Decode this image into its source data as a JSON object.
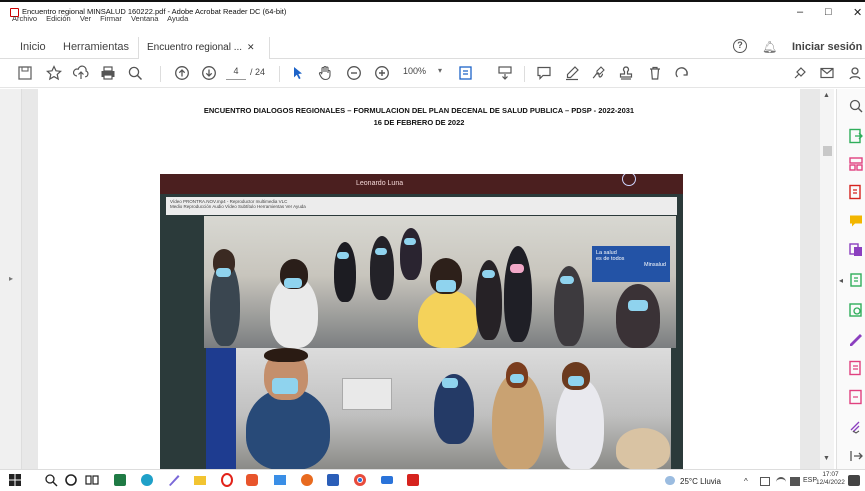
{
  "window": {
    "title": "Encuentro regional MINSALUD 160222.pdf - Adobe Acrobat Reader DC (64-bit)",
    "menu": [
      "Archivo",
      "Edición",
      "Ver",
      "Firmar",
      "Ventana",
      "Ayuda"
    ],
    "controls": {
      "minimize": "–",
      "maximize": "□",
      "close": "✕"
    }
  },
  "tabs": {
    "home": "Inicio",
    "tools": "Herramientas",
    "document": "Encuentro regional ...",
    "close": "✕"
  },
  "header_right": {
    "help": "?",
    "signin": "Iniciar sesión"
  },
  "toolbar": {
    "current_page": "4",
    "page_count": "/ 24",
    "zoom": "100%",
    "zoom_caret": "▾",
    "icons": [
      "save-icon",
      "bookmark-star-icon",
      "upload-icon",
      "print-icon",
      "search-zoom-icon",
      "page-up-icon",
      "page-down-icon",
      "select-cursor-icon",
      "hand-icon",
      "zoom-out-icon",
      "zoom-in-icon",
      "fit-page-icon",
      "read-mode-icon",
      "comment-icon",
      "highlight-pen-icon",
      "sign-icon",
      "stamp-icon",
      "delete-icon",
      "rotate-icon",
      "share-link-icon",
      "email-icon",
      "account-icon"
    ]
  },
  "document": {
    "heading_line1": "ENCUENTRO DIALOGOS REGIONALES – FORMULACION DEL PLAN DECENAL DE SALUD PUBLICA – PDSP - 2022-2031",
    "heading_line2": "16 DE FEBRERO DE 2022",
    "photo": {
      "speaker_label": "Leonardo Luna",
      "player_title": "Vídeo PRONTRA.NOV.mp4 - Reproductor multimedia VLC",
      "player_menu": "Medio  Reproducción  Audio  Vídeo  Subtítulo  Herramientas  Ver  Ayuda",
      "promo_line1": "La salud",
      "promo_line2": "es de todos",
      "promo_org": "Minsalud"
    }
  },
  "scrollbar": {
    "up": "▲",
    "down": "▼"
  },
  "panels": {
    "left_toggle": "▸",
    "right_toggle": "◂"
  },
  "taskbar": {
    "weather": "25°C  Lluvia",
    "tray_caret": "^",
    "language": "ESP",
    "time": "17:07",
    "date": "12/4/2022"
  },
  "colors": {
    "acrobat_red": "#d6231e",
    "toolbar_icon": "#555555",
    "right_tool_pink": "#e0417f",
    "right_tool_green": "#2fae5b",
    "right_tool_purple": "#8b3fbf",
    "right_tool_yellow": "#f2b600",
    "right_tool_blue": "#1f7ed6"
  }
}
